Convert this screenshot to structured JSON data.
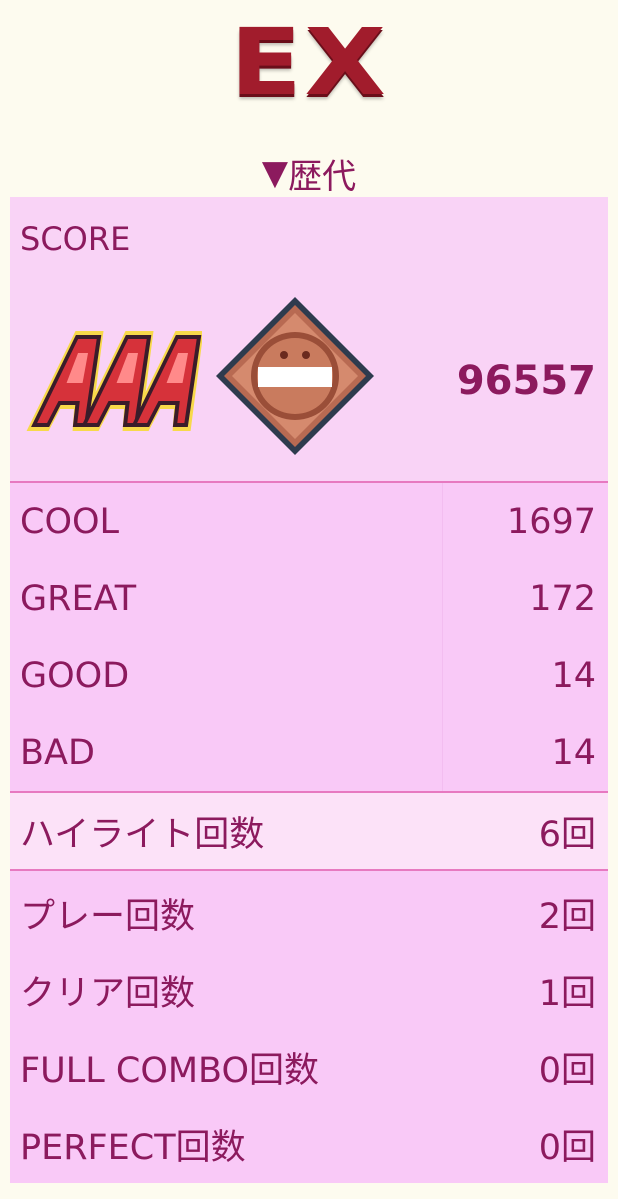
{
  "difficulty": "EX",
  "section": {
    "arrow": "▼",
    "title": "歴代"
  },
  "score": {
    "label": "SCORE",
    "value": "96557",
    "rank_badge_text": "AAA",
    "rank_badge_icon": "rank-aaa-icon",
    "medal_icon": "medal-icon"
  },
  "judgements": [
    {
      "label": "COOL",
      "value": "1697"
    },
    {
      "label": "GREAT",
      "value": "172"
    },
    {
      "label": "GOOD",
      "value": "14"
    },
    {
      "label": "BAD",
      "value": "14"
    }
  ],
  "highlight": {
    "label": "ハイライト回数",
    "value": "6回"
  },
  "counts": [
    {
      "label": "プレー回数",
      "value": "2回"
    },
    {
      "label": "クリア回数",
      "value": "1回"
    },
    {
      "label": "FULL COMBO回数",
      "value": "0回"
    },
    {
      "label": "PERFECT回数",
      "value": "0回"
    }
  ],
  "colors": {
    "background": "#fdfbef",
    "panel": "#f9c9f7",
    "text": "#8c1a5e",
    "divider": "#e779c0",
    "title": "#a11c2c"
  }
}
